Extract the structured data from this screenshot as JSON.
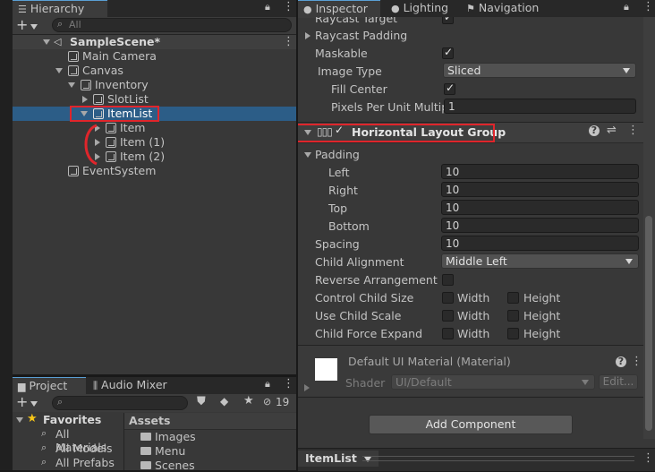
{
  "hierarchy": {
    "tab_label": "Hierarchy",
    "search_placeholder": "All",
    "scene": "SampleScene*",
    "items": [
      {
        "label": "Main Camera"
      },
      {
        "label": "Canvas"
      },
      {
        "label": "Inventory"
      },
      {
        "label": "SlotList"
      },
      {
        "label": "ItemList"
      },
      {
        "label": "Item"
      },
      {
        "label": "Item (1)"
      },
      {
        "label": "Item (2)"
      },
      {
        "label": "EventSystem"
      }
    ]
  },
  "project": {
    "tabs": [
      "Project",
      "Audio Mixer"
    ],
    "hidden_count": "19",
    "favorites": {
      "label": "Favorites",
      "items": [
        "All Materials",
        "All Models",
        "All Prefabs"
      ]
    },
    "assets": {
      "label": "Assets",
      "folders": [
        "Images",
        "Menu",
        "Scenes"
      ]
    }
  },
  "inspector": {
    "tabs": [
      "Inspector",
      "Lighting",
      "Navigation"
    ],
    "image": {
      "raycast_target": "Raycast Target",
      "raycast_padding": "Raycast Padding",
      "maskable": "Maskable",
      "image_type_label": "Image Type",
      "image_type_value": "Sliced",
      "fill_center": "Fill Center",
      "ppu_label": "Pixels Per Unit Multipli",
      "ppu_value": "1"
    },
    "layout_group": {
      "title": "Horizontal Layout Group",
      "padding": "Padding",
      "left_label": "Left",
      "left_value": "10",
      "right_label": "Right",
      "right_value": "10",
      "top_label": "Top",
      "top_value": "10",
      "bottom_label": "Bottom",
      "bottom_value": "10",
      "spacing_label": "Spacing",
      "spacing_value": "10",
      "child_alignment_label": "Child Alignment",
      "child_alignment_value": "Middle Left",
      "reverse_label": "Reverse Arrangement",
      "control_size_label": "Control Child Size",
      "use_scale_label": "Use Child Scale",
      "force_expand_label": "Child Force Expand",
      "width": "Width",
      "height": "Height"
    },
    "material": {
      "name": "Default UI Material (Material)",
      "shader_label": "Shader",
      "shader_value": "UI/Default",
      "edit": "Edit..."
    },
    "add_component": "Add Component",
    "footer_label": "ItemList"
  },
  "colors": {
    "selection": "#2c5d87",
    "highlight": "#e0252b",
    "panel": "#383838"
  }
}
